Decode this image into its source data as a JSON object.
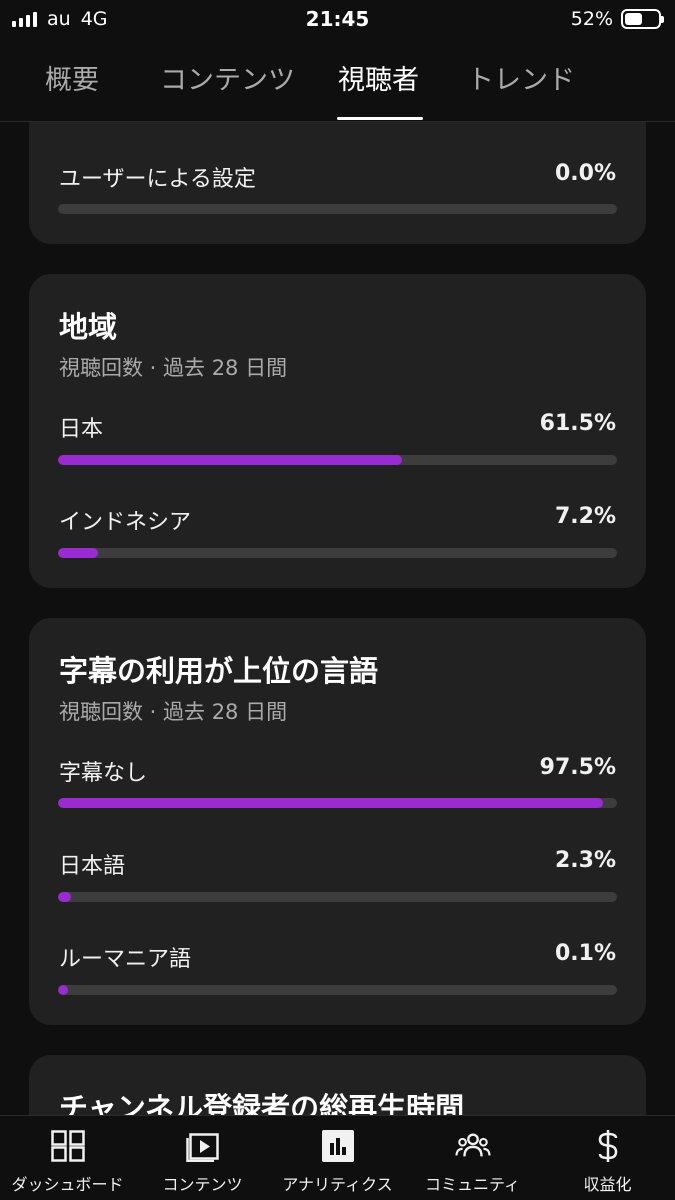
{
  "status": {
    "carrier": "au",
    "network": "4G",
    "time": "21:45",
    "battery": "52%",
    "battery_level": 0.52
  },
  "tabs": [
    {
      "label": "概要"
    },
    {
      "label": "コンテンツ"
    },
    {
      "label": "視聴者"
    },
    {
      "label": "トレンド"
    }
  ],
  "card_partial": {
    "label": "ユーザーによる設定",
    "value": "0.0%",
    "percent": 0.0
  },
  "region": {
    "title": "地域",
    "subtitle": "視聴回数 · 過去 28 日間",
    "rows": [
      {
        "label": "日本",
        "value": "61.5%",
        "percent": 61.5
      },
      {
        "label": "インドネシア",
        "value": "7.2%",
        "percent": 7.2
      }
    ]
  },
  "subtitles": {
    "title": "字幕の利用が上位の言語",
    "subtitle": "視聴回数 · 過去 28 日間",
    "rows": [
      {
        "label": "字幕なし",
        "value": "97.5%",
        "percent": 97.5
      },
      {
        "label": "日本語",
        "value": "2.3%",
        "percent": 2.3
      },
      {
        "label": "ルーマニア語",
        "value": "0.1%",
        "percent": 0.1
      }
    ]
  },
  "next_card": {
    "title": "チャンネル登録者の総再生時間"
  },
  "bottom_nav": [
    {
      "label": "ダッシュボード",
      "icon": "dashboard-icon"
    },
    {
      "label": "コンテンツ",
      "icon": "content-icon"
    },
    {
      "label": "アナリティクス",
      "icon": "analytics-icon"
    },
    {
      "label": "コミュニティ",
      "icon": "community-icon"
    },
    {
      "label": "収益化",
      "icon": "dollar-icon"
    }
  ],
  "colors": {
    "accent": "#9a2bd0",
    "card": "#212121",
    "background": "#0f0f0f",
    "track": "#3d3d3d"
  }
}
